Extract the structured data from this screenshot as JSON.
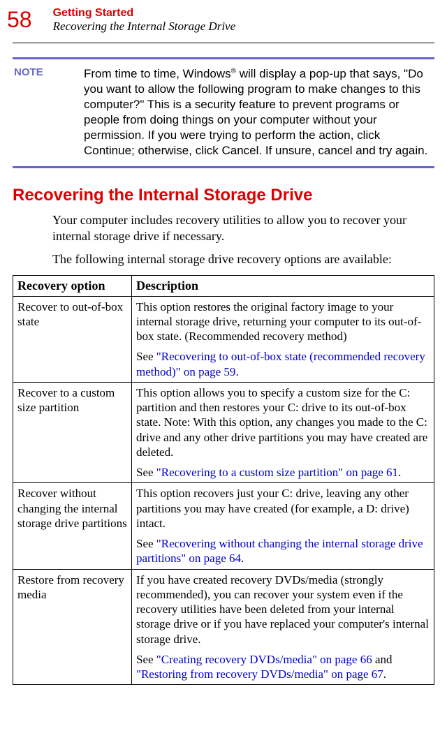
{
  "pageNumber": "58",
  "chapterTitle": "Getting Started",
  "sectionSubtitle": "Recovering the Internal Storage Drive",
  "note": {
    "label": "NOTE",
    "textBefore": "From time to time, Windows",
    "reg": "®",
    "textAfter": " will display a pop-up that says, \"Do you want to allow the following program to make changes to this computer?\" This is a security feature to prevent programs or people from doing things on your computer without your permission. If you were trying to perform the action, click Continue; otherwise, click Cancel. If unsure, cancel and try again."
  },
  "heading": "Recovering the Internal Storage Drive",
  "intro1": "Your computer includes recovery utilities to allow you to recover your internal storage drive if necessary.",
  "intro2": "The following internal storage drive recovery options are available:",
  "table": {
    "headers": {
      "option": "Recovery option",
      "description": "Description"
    },
    "rows": [
      {
        "option": "Recover to out-of-box state",
        "desc1": "This option restores the original factory image to your internal storage drive, returning your computer to its out-of-box state. (Recommended recovery method)",
        "see": "See ",
        "link": "\"Recovering to out-of-box state (recommended recovery method)\" on page 59",
        "after": "."
      },
      {
        "option": "Recover to a custom size partition",
        "desc1": "This option allows you to specify a custom size for the C: partition and then restores your C: drive to its out-of-box state. Note: With this option, any changes you made to the C: drive and any other drive partitions you may have created are deleted.",
        "see": "See ",
        "link": "\"Recovering to a custom size partition\" on page 61",
        "after": "."
      },
      {
        "option": "Recover without changing the internal storage drive partitions",
        "desc1": "This option recovers just your C: drive, leaving any other partitions you may have created (for example, a D: drive) intact.",
        "see": "See ",
        "link": "\"Recovering without changing the internal storage drive partitions\" on page 64",
        "after": "."
      },
      {
        "option": "Restore from recovery media",
        "desc1": "If you have created recovery DVDs/media (strongly recommended), you can recover your system even if the recovery utilities have been deleted from your internal storage drive or if you have replaced your computer's internal storage drive.",
        "see": "See ",
        "link": "\"Creating recovery DVDs/media\" on page 66",
        "mid": " and ",
        "link2": "\"Restoring from recovery DVDs/media\" on page 67",
        "after": "."
      }
    ]
  }
}
